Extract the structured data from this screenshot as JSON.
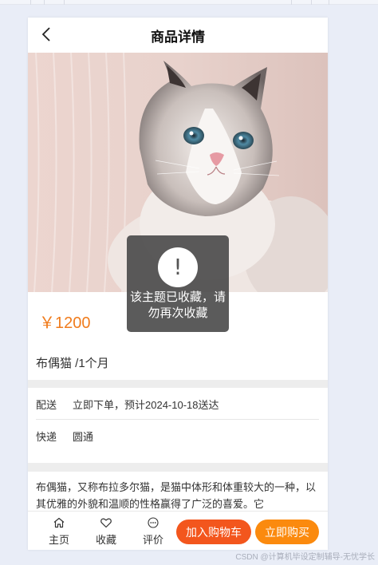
{
  "navbar": {
    "title": "商品详情",
    "back_icon": "chevron-left-icon"
  },
  "product": {
    "price": "￥1200",
    "name": "布偶猫 /1个月",
    "image": "ragdoll-cat-photo",
    "price_color": "#f07c1d"
  },
  "shipping": {
    "delivery_label": "配送",
    "delivery_value": "立即下单，预计2024-10-18送达",
    "courier_label": "快递",
    "courier_value": "圆通"
  },
  "description": {
    "text": "布偶猫，又称布拉多尔猫，是猫中体形和体重较大的一种，以其优雅的外貌和温顺的性格赢得了广泛的喜爱。它"
  },
  "toast": {
    "icon": "exclamation-icon",
    "message": "该主题已收藏，请勿再次收藏"
  },
  "tabbar": {
    "home_label": "主页",
    "home_icon": "home-icon",
    "fav_label": "收藏",
    "fav_icon": "heart-icon",
    "review_label": "评价",
    "review_icon": "comment-icon",
    "add_cart_label": "加入购物车",
    "buy_now_label": "立即购买",
    "add_cart_color": "#f3561d",
    "buy_now_color": "#fb8a0e"
  },
  "watermark": "CSDN @计算机毕设定制辅导-无忧学长"
}
